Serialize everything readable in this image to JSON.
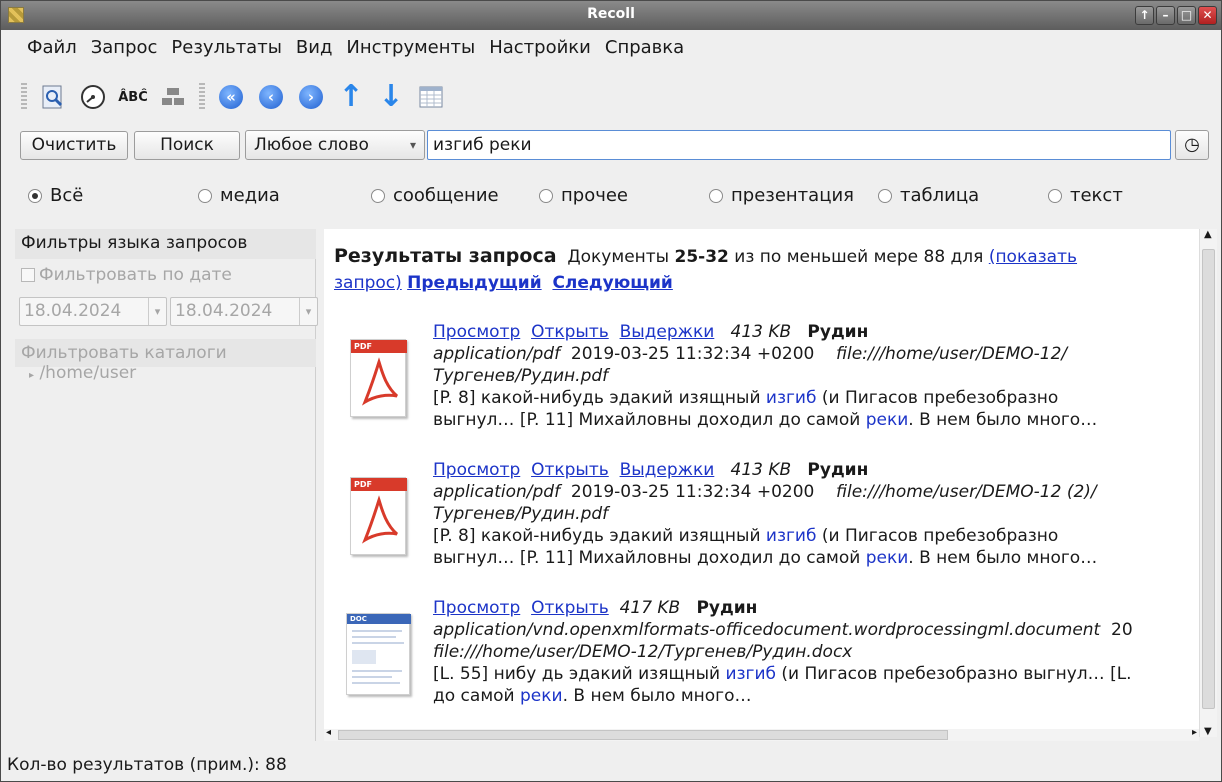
{
  "window": {
    "title": "Recoll"
  },
  "menu": [
    "Файл",
    "Запрос",
    "Результаты",
    "Вид",
    "Инструменты",
    "Настройки",
    "Справка"
  ],
  "search": {
    "clear_label": "Очистить",
    "search_label": "Поиск",
    "mode": "Любое слово",
    "query": "изгиб реки"
  },
  "filters": [
    "Всё",
    "медиа",
    "сообщение",
    "прочее",
    "презентация",
    "таблица",
    "текст"
  ],
  "side": {
    "header": "Фильтры языка запросов",
    "date_filter": "Фильтровать по дате",
    "date_from": "18.04.2024",
    "date_to": "18.04.2024",
    "dir_filter": "Фильтровать каталоги",
    "dir": "/home/user"
  },
  "results": {
    "title": "Результаты запроса",
    "docs_prefix": "Документы",
    "range": "25-32",
    "of_text": "из по меньшей мере 88 для",
    "show_query": "(показать",
    "show_query2": "запрос)",
    "prev": "Предыдущий",
    "next": "Следующий",
    "preview": "Просмотр",
    "open": "Открыть",
    "snippets": "Выдержки",
    "items": [
      {
        "size": "413 KB",
        "name": "Рудин",
        "mime": "application/pdf",
        "date": "2019-03-25 11:32:34 +0200",
        "url1": "file:///home/user/DEMO-12/",
        "url2": "Тургенев/Рудин.pdf",
        "s1a": "[P. 8] какой-нибудь эдакий изящный ",
        "s1h": "изгиб",
        "s1b": " (и Пигасов пребезобразно",
        "s2a": "выгнул… [P. 11] Михайловны доходил до самой ",
        "s2h": "реки",
        "s2b": ". В нем было много…"
      },
      {
        "size": "413 KB",
        "name": "Рудин",
        "mime": "application/pdf",
        "date": "2019-03-25 11:32:34 +0200",
        "url1": "file:///home/user/DEMO-12 (2)/",
        "url2": "Тургенев/Рудин.pdf",
        "s1a": "[P. 8] какой-нибудь эдакий изящный ",
        "s1h": "изгиб",
        "s1b": " (и Пигасов пребезобразно",
        "s2a": "выгнул… [P. 11] Михайловны доходил до самой ",
        "s2h": "реки",
        "s2b": ". В нем было много…"
      },
      {
        "size": "417 KB",
        "name": "Рудин",
        "mime": "application/vnd.openxmlformats-officedocument.wordprocessingml.document",
        "date_clip": "20",
        "url": "file:///home/user/DEMO-12/Тургенев/Рудин.docx",
        "s1a": "[L. 55] нибу дь эдакий изящный ",
        "s1h": "изгиб",
        "s1b": " (и Пигасов пребезобразно выгнул… [L.",
        "s2a": "до самой ",
        "s2h": "реки",
        "s2b": ". В нем было много…"
      }
    ]
  },
  "status": "Кол-во результатов (прим.): 88"
}
